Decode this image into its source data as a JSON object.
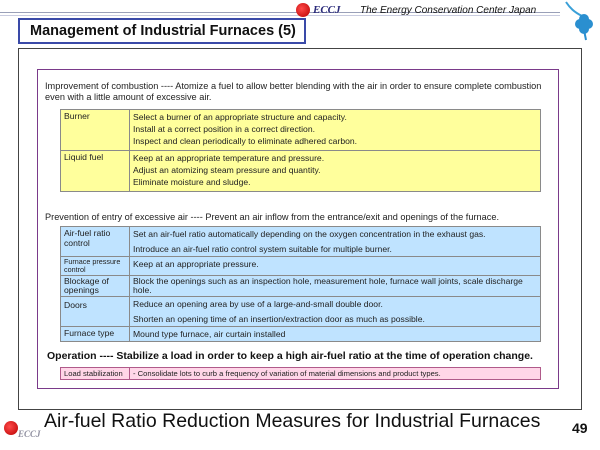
{
  "header": {
    "title": "Management of Industrial Furnaces (5)",
    "logo_text": "ECCJ",
    "org_name": "The Energy Conservation Center Japan"
  },
  "combustion": {
    "intro": "Improvement of combustion ---- Atomize a fuel to allow better blending with the air in order to ensure complete combustion even with a little amount of excessive air.",
    "rows": [
      {
        "label": "Burner",
        "items": [
          "Select a burner of an appropriate structure and capacity.",
          "Install at a correct position in a correct direction.",
          "Inspect and clean periodically to eliminate adhered carbon."
        ]
      },
      {
        "label": "Liquid fuel",
        "items": [
          "Keep at an appropriate temperature and pressure.",
          "Adjust an atomizing steam pressure and quantity.",
          "Eliminate moisture and sludge."
        ]
      }
    ]
  },
  "prevention": {
    "intro": "Prevention of entry of excessive air ---- Prevent an air inflow from the entrance/exit and openings of the furnace.",
    "rows": [
      {
        "label": "Air-fuel ratio control",
        "items": [
          "Set an air-fuel ratio automatically depending on the oxygen concentration in the exhaust gas.",
          "Introduce an air-fuel ratio control system suitable for multiple burner."
        ]
      },
      {
        "label": "Furnace pressure control",
        "items": [
          "Keep at an appropriate pressure."
        ]
      },
      {
        "label": "Blockage of openings",
        "items": [
          "Block the openings such as an inspection hole, measurement hole, furnace wall joints, scale discharge hole."
        ]
      },
      {
        "label": "Doors",
        "items": [
          "Reduce an opening area by use of a large-and-small double door.",
          "Shorten an opening time of an insertion/extraction door as much as possible."
        ]
      },
      {
        "label": "Furnace type",
        "items": [
          "Mound type furnace, air curtain installed"
        ]
      }
    ]
  },
  "operation": {
    "intro": "Operation ---- Stabilize a load in order to keep a high air-fuel ratio at the time of operation change.",
    "rows": [
      {
        "label": "Load stabilization",
        "items": [
          "- Consolidate lots to curb a frequency of variation of material dimensions and product types."
        ]
      }
    ]
  },
  "footer": {
    "title": "Air-fuel Ratio Reduction Measures for Industrial Furnaces",
    "logo_text": "ECCJ",
    "page_number": "49"
  },
  "colors": {
    "yellow": "#ffff9c",
    "blue": "#bfe3ff",
    "pink": "#ffd6e8",
    "title_border": "#3a4aa8"
  }
}
